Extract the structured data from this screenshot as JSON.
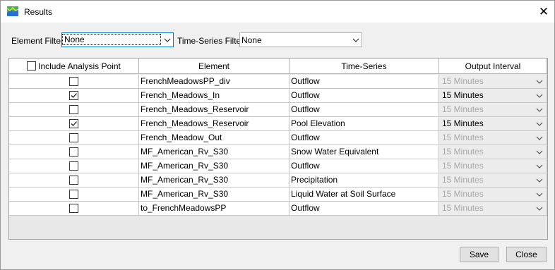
{
  "window": {
    "title": "Results",
    "close_glyph": "✕"
  },
  "filters": {
    "element_label": "Element Filter",
    "element_value": "None",
    "timeseries_label": "Time-Series Filter",
    "timeseries_value": "None"
  },
  "table": {
    "headers": {
      "include": "Include Analysis Point",
      "element": "Element",
      "timeseries": "Time-Series",
      "interval": "Output Interval"
    },
    "include_all_checked": false,
    "rows": [
      {
        "checked": false,
        "element": "FrenchMeadowsPP_div",
        "timeseries": "Outflow",
        "interval": "15 Minutes",
        "enabled": false
      },
      {
        "checked": true,
        "element": "French_Meadows_In",
        "timeseries": "Outflow",
        "interval": "15 Minutes",
        "enabled": true
      },
      {
        "checked": false,
        "element": "French_Meadows_Reservoir",
        "timeseries": "Outflow",
        "interval": "15 Minutes",
        "enabled": false
      },
      {
        "checked": true,
        "element": "French_Meadows_Reservoir",
        "timeseries": "Pool Elevation",
        "interval": "15 Minutes",
        "enabled": true
      },
      {
        "checked": false,
        "element": "French_Meadow_Out",
        "timeseries": "Outflow",
        "interval": "15 Minutes",
        "enabled": false
      },
      {
        "checked": false,
        "element": "MF_American_Rv_S30",
        "timeseries": "Snow Water Equivalent",
        "interval": "15 Minutes",
        "enabled": false
      },
      {
        "checked": false,
        "element": "MF_American_Rv_S30",
        "timeseries": "Outflow",
        "interval": "15 Minutes",
        "enabled": false
      },
      {
        "checked": false,
        "element": "MF_American_Rv_S30",
        "timeseries": "Precipitation",
        "interval": "15 Minutes",
        "enabled": false
      },
      {
        "checked": false,
        "element": "MF_American_Rv_S30",
        "timeseries": "Liquid Water at Soil Surface",
        "interval": "15 Minutes",
        "enabled": false
      },
      {
        "checked": false,
        "element": "to_FrenchMeadowsPP",
        "timeseries": "Outflow",
        "interval": "15 Minutes",
        "enabled": false
      }
    ]
  },
  "buttons": {
    "save": "Save",
    "close": "Close"
  },
  "colors": {
    "disabled_text": "#a8a8a8",
    "focus_border": "#0078d7"
  },
  "icons": {
    "app": "hec-hms-app-icon",
    "dropdown": "chevron-down-icon",
    "check": "checkmark-icon"
  }
}
